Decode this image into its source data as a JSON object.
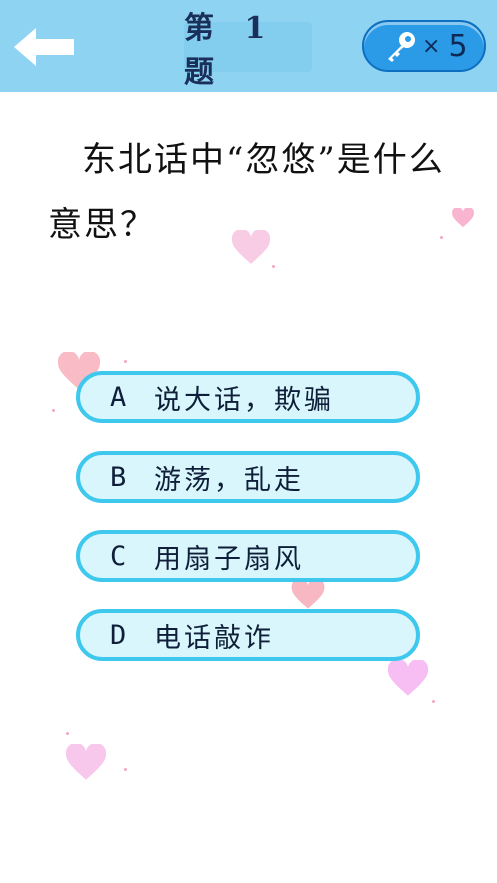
{
  "header": {
    "title": "第 1 题",
    "key_times": "×",
    "key_count": "5"
  },
  "question": {
    "text": "东北话中“忽悠”是什么意思？"
  },
  "options": [
    {
      "letter": "A",
      "text": "说大话，欺骗"
    },
    {
      "letter": "B",
      "text": "游荡，乱走"
    },
    {
      "letter": "C",
      "text": "用扇子扇风"
    },
    {
      "letter": "D",
      "text": "电话敲诈"
    }
  ],
  "colors": {
    "header_bg": "#8fd3f3",
    "option_border": "#3ec8ee",
    "option_fill": "#d8f6fb",
    "key_pill": "#2b9be8",
    "heart_pink": "#f7a8c8",
    "heart_violet": "#f3b2f0"
  },
  "icons": {
    "back": "back-arrow-icon",
    "key": "key-icon",
    "decoration": "heart-icon"
  }
}
